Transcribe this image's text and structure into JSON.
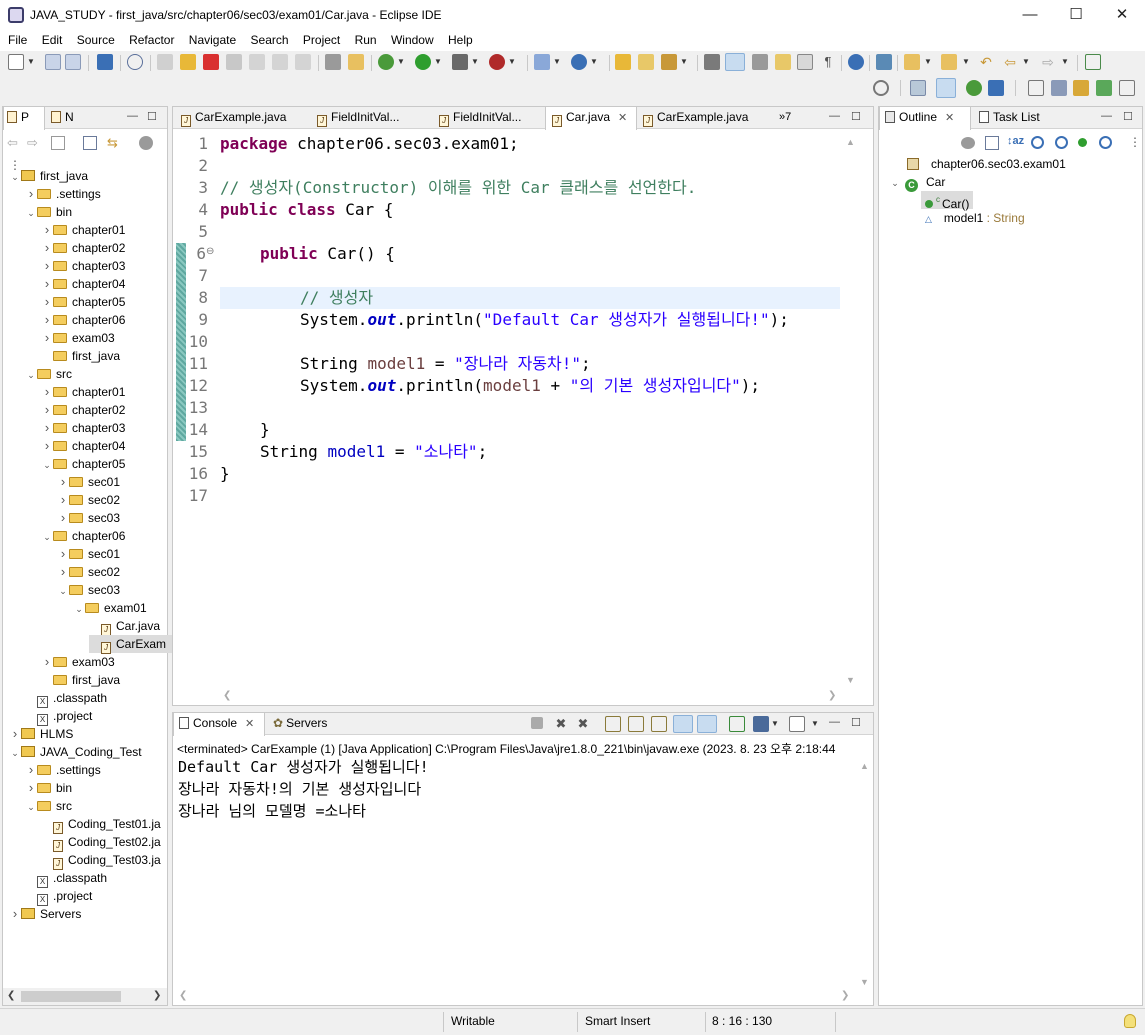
{
  "window": {
    "title": "JAVA_STUDY - first_java/src/chapter06/sec03/exam01/Car.java - Eclipse IDE"
  },
  "menu": [
    "File",
    "Edit",
    "Source",
    "Refactor",
    "Navigate",
    "Search",
    "Project",
    "Run",
    "Window",
    "Help"
  ],
  "explorer": {
    "tabs": [
      {
        "label": "P"
      },
      {
        "label": "N"
      }
    ],
    "tree": [
      {
        "label": "first_java",
        "depth": 0,
        "kind": "project",
        "open": true
      },
      {
        "label": ".settings",
        "depth": 1,
        "kind": "folder",
        "open": false
      },
      {
        "label": "bin",
        "depth": 1,
        "kind": "folder",
        "open": true
      },
      {
        "label": "chapter01",
        "depth": 2,
        "kind": "folder",
        "open": false
      },
      {
        "label": "chapter02",
        "depth": 2,
        "kind": "folder",
        "open": false
      },
      {
        "label": "chapter03",
        "depth": 2,
        "kind": "folder",
        "open": false
      },
      {
        "label": "chapter04",
        "depth": 2,
        "kind": "folder",
        "open": false
      },
      {
        "label": "chapter05",
        "depth": 2,
        "kind": "folder",
        "open": false
      },
      {
        "label": "chapter06",
        "depth": 2,
        "kind": "folder",
        "open": false
      },
      {
        "label": "exam03",
        "depth": 2,
        "kind": "folder",
        "open": false
      },
      {
        "label": "first_java",
        "depth": 2,
        "kind": "folder",
        "open": null
      },
      {
        "label": "src",
        "depth": 1,
        "kind": "folder",
        "open": true
      },
      {
        "label": "chapter01",
        "depth": 2,
        "kind": "folder",
        "open": false
      },
      {
        "label": "chapter02",
        "depth": 2,
        "kind": "folder",
        "open": false
      },
      {
        "label": "chapter03",
        "depth": 2,
        "kind": "folder",
        "open": false
      },
      {
        "label": "chapter04",
        "depth": 2,
        "kind": "folder",
        "open": false
      },
      {
        "label": "chapter05",
        "depth": 2,
        "kind": "folder",
        "open": true
      },
      {
        "label": "sec01",
        "depth": 3,
        "kind": "folder",
        "open": false
      },
      {
        "label": "sec02",
        "depth": 3,
        "kind": "folder",
        "open": false
      },
      {
        "label": "sec03",
        "depth": 3,
        "kind": "folder",
        "open": false
      },
      {
        "label": "chapter06",
        "depth": 2,
        "kind": "folder",
        "open": true
      },
      {
        "label": "sec01",
        "depth": 3,
        "kind": "folder",
        "open": false
      },
      {
        "label": "sec02",
        "depth": 3,
        "kind": "folder",
        "open": false
      },
      {
        "label": "sec03",
        "depth": 3,
        "kind": "folder",
        "open": true
      },
      {
        "label": "exam01",
        "depth": 4,
        "kind": "folder",
        "open": true
      },
      {
        "label": "Car.java",
        "depth": 5,
        "kind": "java",
        "open": null
      },
      {
        "label": "CarExam",
        "depth": 5,
        "kind": "java",
        "open": null,
        "selected": true
      },
      {
        "label": "exam03",
        "depth": 2,
        "kind": "folder",
        "open": false
      },
      {
        "label": "first_java",
        "depth": 2,
        "kind": "folder",
        "open": null
      },
      {
        "label": ".classpath",
        "depth": 1,
        "kind": "xml",
        "open": null
      },
      {
        "label": ".project",
        "depth": 1,
        "kind": "xml",
        "open": null
      },
      {
        "label": "HLMS",
        "depth": 0,
        "kind": "project",
        "open": false
      },
      {
        "label": "JAVA_Coding_Test",
        "depth": 0,
        "kind": "project",
        "open": true
      },
      {
        "label": ".settings",
        "depth": 1,
        "kind": "folder",
        "open": false
      },
      {
        "label": "bin",
        "depth": 1,
        "kind": "folder",
        "open": false
      },
      {
        "label": "src",
        "depth": 1,
        "kind": "folder",
        "open": true
      },
      {
        "label": "Coding_Test01.ja",
        "depth": 2,
        "kind": "java",
        "open": null
      },
      {
        "label": "Coding_Test02.ja",
        "depth": 2,
        "kind": "java",
        "open": null
      },
      {
        "label": "Coding_Test03.ja",
        "depth": 2,
        "kind": "java",
        "open": null
      },
      {
        "label": ".classpath",
        "depth": 1,
        "kind": "xml",
        "open": null
      },
      {
        "label": ".project",
        "depth": 1,
        "kind": "xml",
        "open": null
      },
      {
        "label": "Servers",
        "depth": 0,
        "kind": "project",
        "open": false
      }
    ]
  },
  "editor": {
    "tabs": [
      {
        "label": "CarExample.java",
        "active": false
      },
      {
        "label": "FieldInitVal...",
        "active": false
      },
      {
        "label": "FieldInitVal...",
        "active": false
      },
      {
        "label": "Car.java",
        "active": true
      },
      {
        "label": "CarExample.java",
        "active": false
      }
    ],
    "overflow": "»7",
    "lines": [
      "1",
      "2",
      "3",
      "4",
      "5",
      "6",
      "7",
      "8",
      "9",
      "10",
      "11",
      "12",
      "13",
      "14",
      "15",
      "16",
      "17"
    ]
  },
  "code": {
    "l1_kw": "package",
    "l1_rest": " chapter06.sec03.exam01;",
    "l3_comment": "// 생성자(Constructor) 이해를 위한 Car 클래스를 선언한다.",
    "l4_kw": "public class",
    "l4_rest": " Car {",
    "l6_kw": "public",
    "l6_rest": " Car() {",
    "l8_comment": "// 생성자",
    "l9_a": "System.",
    "l9_out": "out",
    "l9_b": ".println(",
    "l9_str": "\"Default Car 생성자가 실행됩니다!\"",
    "l9_c": ");",
    "l11_a": "String ",
    "l11_var": "model1",
    "l11_b": " = ",
    "l11_str": "\"장나라 자동차!\"",
    "l11_c": ";",
    "l12_a": "System.",
    "l12_out": "out",
    "l12_b": ".println(",
    "l12_var": "model1",
    "l12_c": " + ",
    "l12_str": "\"의 기본 생성자입니다\"",
    "l12_d": ");",
    "l14": "}",
    "l15_a": "String ",
    "l15_field": "model1",
    "l15_b": " = ",
    "l15_str": "\"소나타\"",
    "l15_c": ";",
    "l16": "}"
  },
  "outline": {
    "tabs": [
      {
        "label": "Outline"
      },
      {
        "label": "Task List"
      }
    ],
    "package": "chapter06.sec03.exam01",
    "class": "Car",
    "constructor": "Car()",
    "field": "model1",
    "field_type": " : String"
  },
  "console": {
    "tabs": [
      {
        "label": "Console"
      },
      {
        "label": "Servers"
      }
    ],
    "status": "<terminated> CarExample (1) [Java Application] C:\\Program Files\\Java\\jre1.8.0_221\\bin\\javaw.exe  (2023. 8. 23 오후 2:18:44",
    "output": [
      "Default Car 생성자가 실행됩니다!",
      "장나라 자동차!의 기본 생성자입니다",
      "장나라 님의 모델명 =소나타"
    ]
  },
  "status": {
    "writable": "Writable",
    "insert": "Smart Insert",
    "position": "8 : 16 : 130"
  },
  "colors": {
    "keyword": "#7f0055",
    "comment": "#3f7f5f",
    "string": "#2a00ff",
    "field": "#0000c0",
    "current_line": "#e8f2fe",
    "change_bar": "#5fa8a0"
  }
}
